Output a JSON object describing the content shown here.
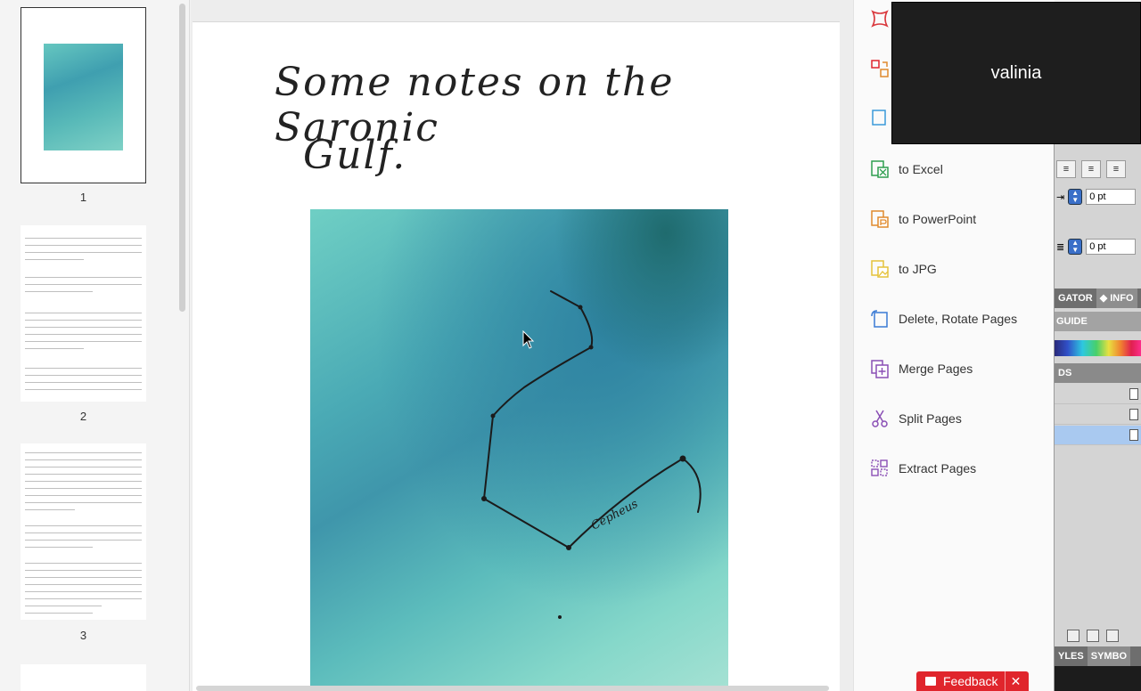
{
  "thumbnails": [
    {
      "number": "1"
    },
    {
      "number": "2"
    },
    {
      "number": "3"
    }
  ],
  "page": {
    "title_line1": "Some notes on the Saronic",
    "title_line2": "Gulf.",
    "sketch_label": "Cepheus"
  },
  "tools": {
    "items": [
      {
        "label": "to Excel",
        "icon": "excel-export-icon",
        "color": "#2e9e4f"
      },
      {
        "label": "to PowerPoint",
        "icon": "powerpoint-export-icon",
        "color": "#e08a2c"
      },
      {
        "label": "to JPG",
        "icon": "jpg-export-icon",
        "color": "#e5c23a"
      },
      {
        "label": "Delete, Rotate Pages",
        "icon": "rotate-pages-icon",
        "color": "#3a7bd5"
      },
      {
        "label": "Merge Pages",
        "icon": "merge-pages-icon",
        "color": "#8a4fb5"
      },
      {
        "label": "Split Pages",
        "icon": "split-pages-icon",
        "color": "#8a4fb5"
      },
      {
        "label": "Extract Pages",
        "icon": "extract-pages-icon",
        "color": "#8a4fb5"
      }
    ]
  },
  "background_app": {
    "spacing_before": "0 pt",
    "spacing_after": "0 pt",
    "tab_navigator": "GATOR",
    "tab_info": "INFO",
    "guide_label": "GUIDE",
    "ds_label": "DS",
    "tab_styles": "YLES",
    "tab_symbols": "SYMBO"
  },
  "overlay": {
    "name": "valinia"
  },
  "feedback": {
    "label": "Feedback",
    "close": "✕"
  },
  "colors": {
    "accent_red": "#e0252c",
    "selection_blue": "#a9c9f0"
  }
}
